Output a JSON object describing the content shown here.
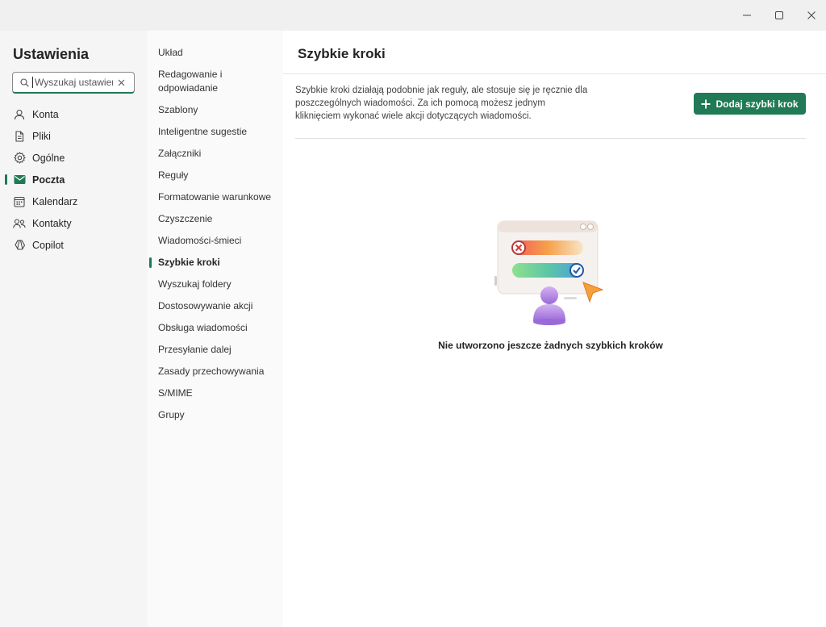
{
  "window": {
    "controls": [
      {
        "name": "minimize-button"
      },
      {
        "name": "maximize-button"
      },
      {
        "name": "close-window-button"
      }
    ]
  },
  "settings": {
    "title": "Ustawienia",
    "search": {
      "placeholder": "Wyszukaj ustawien",
      "value": ""
    },
    "categories": [
      {
        "label": "Konta",
        "icon": "person-icon",
        "active": false
      },
      {
        "label": "Pliki",
        "icon": "file-icon",
        "active": false
      },
      {
        "label": "Ogólne",
        "icon": "gear-icon",
        "active": false
      },
      {
        "label": "Poczta",
        "icon": "mail-icon",
        "active": true
      },
      {
        "label": "Kalendarz",
        "icon": "calendar-icon",
        "active": false
      },
      {
        "label": "Kontakty",
        "icon": "people-icon",
        "active": false
      },
      {
        "label": "Copilot",
        "icon": "copilot-icon",
        "active": false
      }
    ]
  },
  "mail_sections": [
    {
      "label": "Układ",
      "active": false
    },
    {
      "label": "Redagowanie i odpowiadanie",
      "active": false
    },
    {
      "label": "Szablony",
      "active": false
    },
    {
      "label": "Inteligentne sugestie",
      "active": false
    },
    {
      "label": "Załączniki",
      "active": false
    },
    {
      "label": "Reguły",
      "active": false
    },
    {
      "label": "Formatowanie warunkowe",
      "active": false
    },
    {
      "label": "Czyszczenie",
      "active": false
    },
    {
      "label": "Wiadomości-śmieci",
      "active": false
    },
    {
      "label": "Szybkie kroki",
      "active": true
    },
    {
      "label": "Wyszukaj foldery",
      "active": false
    },
    {
      "label": "Dostosowywanie akcji",
      "active": false
    },
    {
      "label": "Obsługa wiadomości",
      "active": false
    },
    {
      "label": "Przesyłanie dalej",
      "active": false
    },
    {
      "label": "Zasady przechowywania",
      "active": false
    },
    {
      "label": "S/MIME",
      "active": false
    },
    {
      "label": "Grupy",
      "active": false
    }
  ],
  "main": {
    "title": "Szybkie kroki",
    "description_lines": [
      "Szybkie kroki działają podobnie jak reguły, ale stosuje się je ręcznie dla",
      "poszczególnych wiadomości. Za ich pomocą możesz jednym",
      "kliknięciem wykonać wiele akcji dotyczących wiadomości."
    ],
    "add_button": "Dodaj szybki krok",
    "empty_message": "Nie utworzono jeszcze żadnych szybkich kroków"
  },
  "colors": {
    "accent": "#1f7a55",
    "illustration_purple": "#b48ee6"
  }
}
